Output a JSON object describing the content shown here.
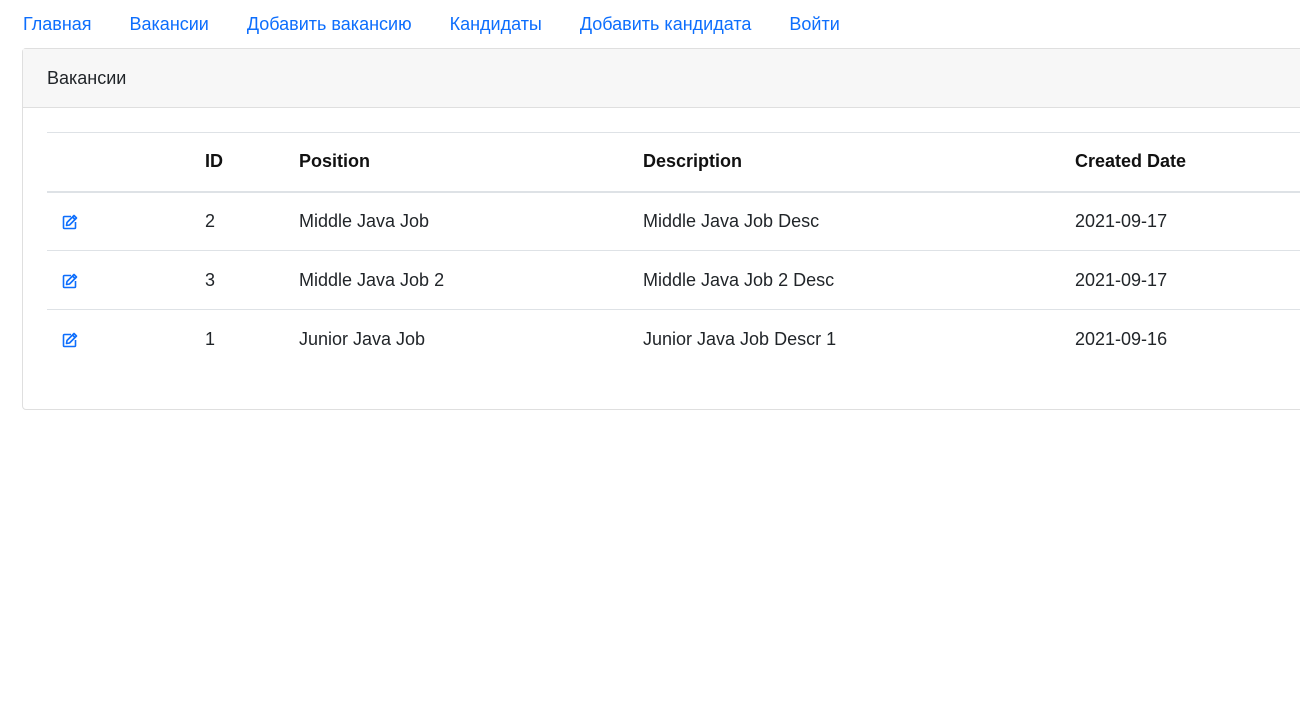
{
  "nav": {
    "items": [
      {
        "label": "Главная"
      },
      {
        "label": "Вакансии"
      },
      {
        "label": "Добавить вакансию"
      },
      {
        "label": "Кандидаты"
      },
      {
        "label": "Добавить кандидата"
      },
      {
        "label": "Войти"
      }
    ]
  },
  "card": {
    "title": "Вакансии"
  },
  "table": {
    "headers": {
      "edit": "",
      "id": "ID",
      "position": "Position",
      "description": "Description",
      "created": "Created Date"
    },
    "rows": [
      {
        "icon": "edit-icon",
        "id": "2",
        "position": "Middle Java Job",
        "description": "Middle Java Job Desc",
        "created": "2021-09-17"
      },
      {
        "icon": "edit-icon",
        "id": "3",
        "position": "Middle Java Job 2",
        "description": "Middle Java Job 2 Desc",
        "created": "2021-09-17"
      },
      {
        "icon": "edit-icon",
        "id": "1",
        "position": "Junior Java Job",
        "description": "Junior Java Job Descr 1",
        "created": "2021-09-16"
      }
    ]
  },
  "colors": {
    "link": "#0d6efd",
    "header_bg": "#f7f7f7",
    "border": "#dee2e6"
  }
}
